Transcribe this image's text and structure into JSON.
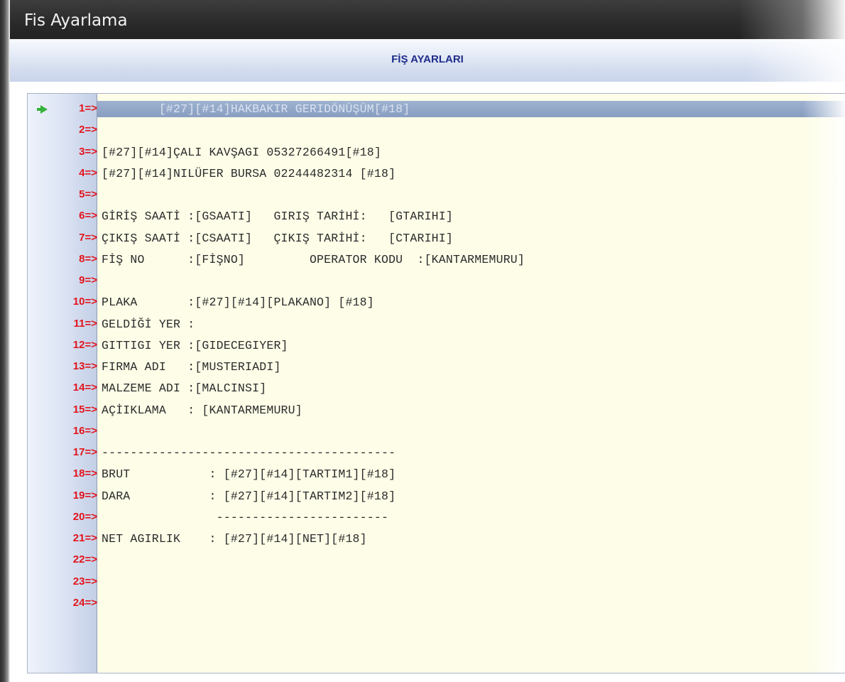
{
  "window": {
    "title": "Fis Ayarlama"
  },
  "header": {
    "title": "FİŞ AYARLARI"
  },
  "editor": {
    "current_line": 1,
    "lines": [
      {
        "num": "1=>",
        "text": "        [#27][#14]HAKBAKIR GERIDÖNÜŞÜM[#18]"
      },
      {
        "num": "2=>",
        "text": ""
      },
      {
        "num": "3=>",
        "text": "[#27][#14]ÇALI KAVŞAGI 05327266491[#18]"
      },
      {
        "num": "4=>",
        "text": "[#27][#14]NILÜFER BURSA 02244482314 [#18]"
      },
      {
        "num": "5=>",
        "text": ""
      },
      {
        "num": "6=>",
        "text": "GİRİŞ SAATİ :[GSAATI]   GIRIŞ TARİHİ:   [GTARIHI]"
      },
      {
        "num": "7=>",
        "text": "ÇIKIŞ SAATİ :[CSAATI]   ÇIKIŞ TARİHİ:   [CTARIHI]"
      },
      {
        "num": "8=>",
        "text": "FİŞ NO      :[FİŞNO]         OPERATOR KODU  :[KANTARMEMURU]"
      },
      {
        "num": "9=>",
        "text": ""
      },
      {
        "num": "10=>",
        "text": "PLAKA       :[#27][#14][PLAKANO] [#18]"
      },
      {
        "num": "11=>",
        "text": "GELDİĞİ YER :"
      },
      {
        "num": "12=>",
        "text": "GITTIGI YER :[GIDECEGIYER]"
      },
      {
        "num": "13=>",
        "text": "FIRMA ADI   :[MUSTERIADI]"
      },
      {
        "num": "14=>",
        "text": "MALZEME ADI :[MALCINSI]"
      },
      {
        "num": "15=>",
        "text": "AÇİIKLAMA   : [KANTARMEMURU]"
      },
      {
        "num": "16=>",
        "text": ""
      },
      {
        "num": "17=>",
        "text": "-----------------------------------------"
      },
      {
        "num": "18=>",
        "text": "BRUT           : [#27][#14][TARTIM1][#18]"
      },
      {
        "num": "19=>",
        "text": "DARA           : [#27][#14][TARTIM2][#18]"
      },
      {
        "num": "20=>",
        "text": "                ------------------------"
      },
      {
        "num": "21=>",
        "text": "NET AGIRLIK    : [#27][#14][NET][#18]"
      },
      {
        "num": "22=>",
        "text": ""
      },
      {
        "num": "23=>",
        "text": ""
      },
      {
        "num": "24=>",
        "text": ""
      }
    ]
  }
}
